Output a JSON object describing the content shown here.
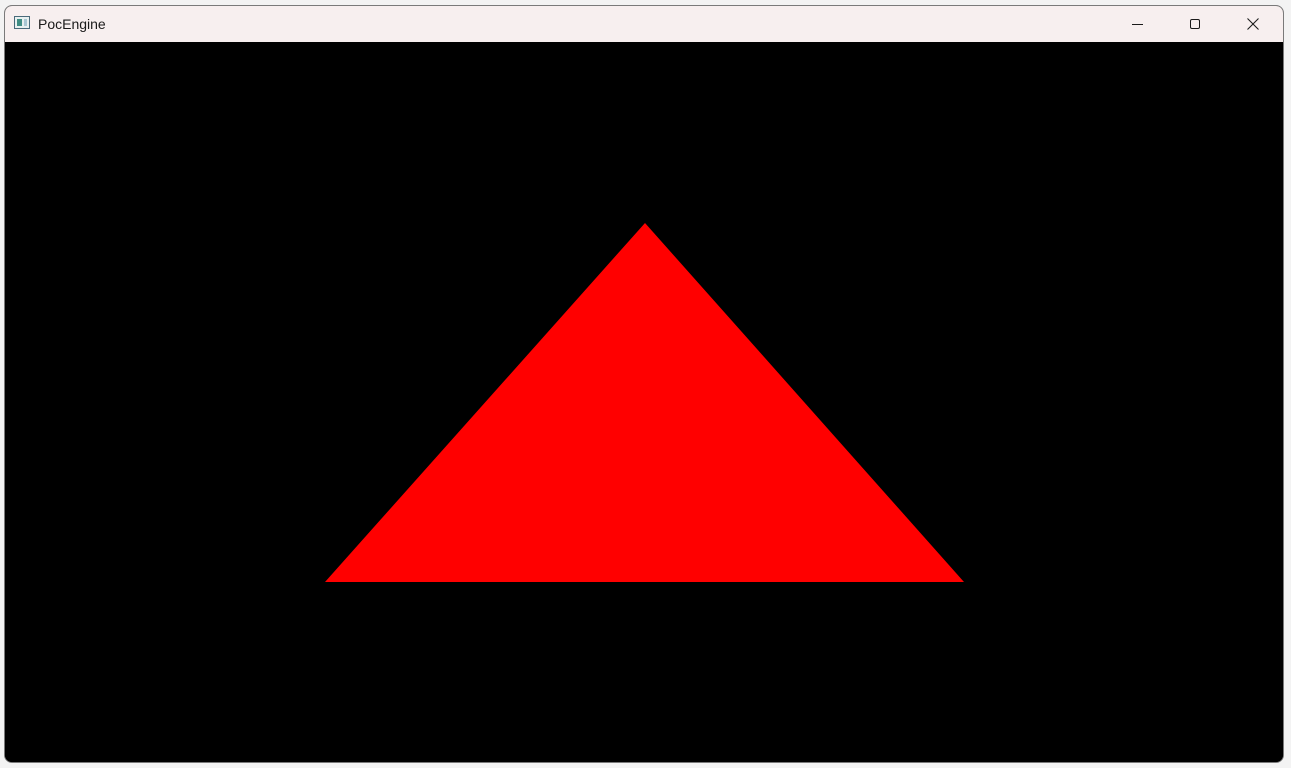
{
  "window": {
    "title": "PocEngine",
    "app_icon": "app-window-icon"
  },
  "caption_buttons": [
    {
      "name": "minimize",
      "icon": "minimize-icon"
    },
    {
      "name": "maximize",
      "icon": "maximize-icon"
    },
    {
      "name": "close",
      "icon": "close-icon"
    }
  ],
  "viewport": {
    "background_color": "#000000",
    "shape": "triangle",
    "shape_color": "#ff0000"
  }
}
